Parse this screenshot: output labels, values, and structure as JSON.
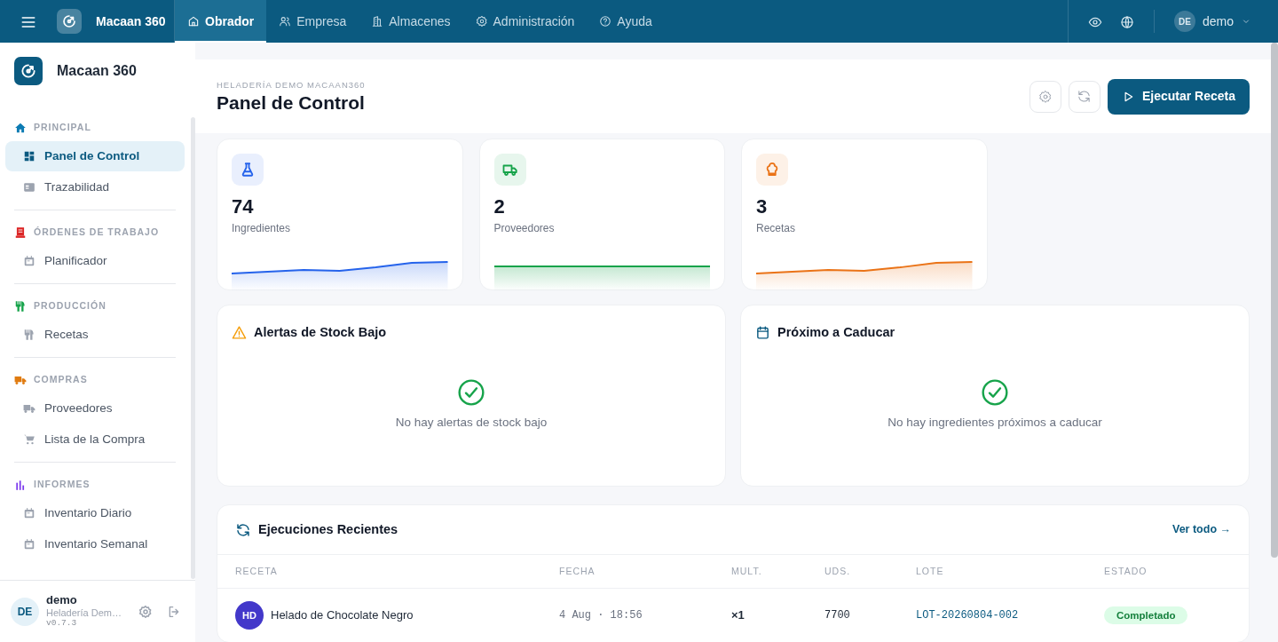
{
  "topbar": {
    "brand": "Macaan 360",
    "tabs": [
      {
        "label": "Obrador",
        "selected": true
      },
      {
        "label": "Empresa",
        "selected": false
      },
      {
        "label": "Almacenes",
        "selected": false
      },
      {
        "label": "Administración",
        "selected": false
      },
      {
        "label": "Ayuda",
        "selected": false
      }
    ],
    "user": {
      "initials": "DE",
      "name": "demo"
    }
  },
  "sidebar": {
    "brand": "Macaan 360",
    "sections": [
      {
        "title": "PRINCIPAL",
        "color": "#0c7bb3",
        "items": [
          {
            "label": "Panel de Control",
            "selected": true
          },
          {
            "label": "Trazabilidad",
            "selected": false
          }
        ]
      },
      {
        "title": "ÓRDENES DE TRABAJO",
        "color": "#dc2626",
        "items": [
          {
            "label": "Planificador",
            "selected": false
          }
        ]
      },
      {
        "title": "PRODUCCIÓN",
        "color": "#16a34a",
        "items": [
          {
            "label": "Recetas",
            "selected": false
          }
        ]
      },
      {
        "title": "COMPRAS",
        "color": "#e07b10",
        "items": [
          {
            "label": "Proveedores",
            "selected": false
          },
          {
            "label": "Lista de la Compra",
            "selected": false
          }
        ]
      },
      {
        "title": "INFORMES",
        "color": "#7c3aed",
        "items": [
          {
            "label": "Inventario Diario",
            "selected": false
          },
          {
            "label": "Inventario Semanal",
            "selected": false
          }
        ]
      }
    ],
    "footer": {
      "initials": "DE",
      "name": "demo",
      "company": "Heladería Dem…",
      "version": "v0.7.3"
    }
  },
  "header": {
    "eyebrow": "HELADERÍA DEMO MACAAN360",
    "title": "Panel de Control",
    "primary_button": "Ejecutar Receta"
  },
  "stats": [
    {
      "value": "74",
      "label": "Ingredientes",
      "color": "#2563eb"
    },
    {
      "value": "2",
      "label": "Proveedores",
      "color": "#16a34a"
    },
    {
      "value": "3",
      "label": "Recetas",
      "color": "#ea7317"
    }
  ],
  "panels": [
    {
      "title": "Alertas de Stock Bajo",
      "empty_text": "No hay alertas de stock bajo"
    },
    {
      "title": "Próximo a Caducar",
      "empty_text": "No hay ingredientes próximos a caducar"
    }
  ],
  "recent": {
    "title": "Ejecuciones Recientes",
    "link": "Ver todo →",
    "columns": [
      "RECETA",
      "FECHA",
      "MULT.",
      "UDS.",
      "LOTE",
      "ESTADO"
    ],
    "rows": [
      {
        "initials": "HD",
        "recipe": "Helado de Chocolate Negro",
        "date": "4 Aug · 18:56",
        "mult": "×1",
        "units": "7700",
        "lot": "LOT-20260804-002",
        "status": "Completado"
      }
    ]
  }
}
